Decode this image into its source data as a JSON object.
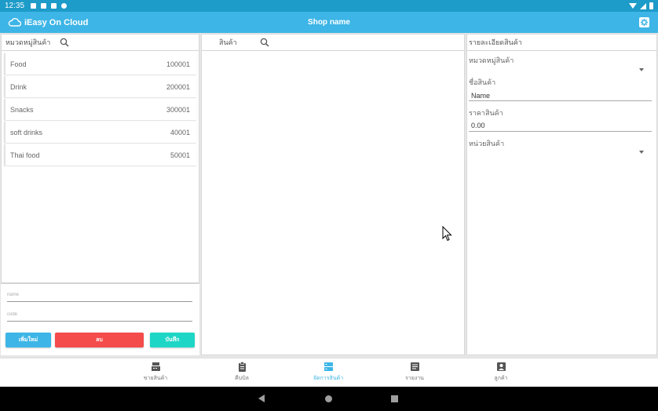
{
  "status_bar": {
    "time": "12:35"
  },
  "app_bar": {
    "brand": "iEasy On Cloud",
    "shop_name": "Shop name"
  },
  "categories_panel": {
    "title": "หมวดหมู่สินค้า",
    "items": [
      {
        "name": "Food",
        "code": "100001"
      },
      {
        "name": "Drink",
        "code": "200001"
      },
      {
        "name": "Snacks",
        "code": "300001"
      },
      {
        "name": "soft drinks",
        "code": "40001"
      },
      {
        "name": "Thai food",
        "code": "50001"
      }
    ],
    "form": {
      "name_placeholder": "name",
      "code_placeholder": "code",
      "add_label": "เพิ่มใหม่",
      "delete_label": "ลบ",
      "save_label": "บันทึก"
    }
  },
  "products_panel": {
    "title": "สินค้า"
  },
  "details_panel": {
    "title": "รายละเอียดสินค้า",
    "category_label": "หมวดหมู่สินค้า",
    "name_label": "ชื่อสินค้า",
    "name_value": "Name",
    "price_label": "ราคาสินค้า",
    "price_value": "0.00",
    "unit_label": "หน่วยสินค้า"
  },
  "bottom_nav": {
    "items": [
      {
        "label": "ขายสินค้า",
        "icon": "cash-register-icon"
      },
      {
        "label": "คีบบิล",
        "icon": "clipboard-icon"
      },
      {
        "label": "จัดการสินค้า",
        "icon": "storage-icon",
        "active": true
      },
      {
        "label": "รายงาน",
        "icon": "report-icon"
      },
      {
        "label": "ลูกค้า",
        "icon": "customer-icon"
      }
    ]
  },
  "colors": {
    "status_bar": "#1d9bc9",
    "app_bar": "#3db5e6",
    "add_button": "#3db5e6",
    "delete_button": "#f44b4b",
    "save_button": "#1ed6c6",
    "active_nav": "#3db5e6"
  }
}
